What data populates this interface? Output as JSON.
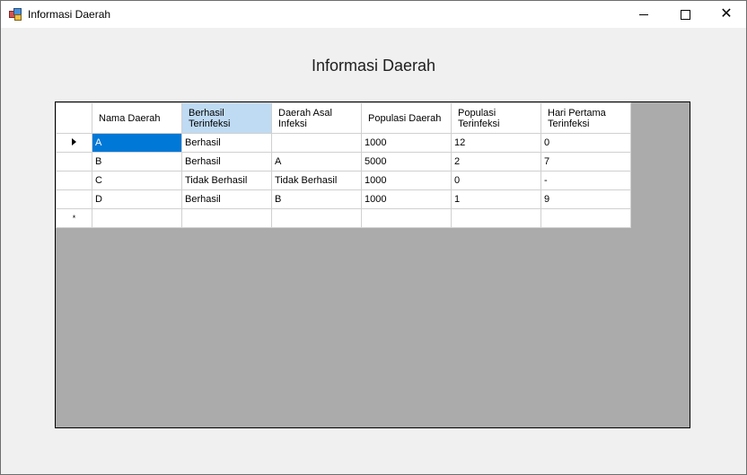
{
  "window": {
    "title": "Informasi Daerah",
    "icon": "app-form-icon",
    "minimize_icon": "minimize-icon",
    "maximize_icon": "maximize-icon",
    "close_icon": "close-icon"
  },
  "form": {
    "heading": "Informasi Daerah"
  },
  "grid": {
    "columns": [
      "Nama Daerah",
      "Berhasil Terinfeksi",
      "Daerah Asal Infeksi",
      "Populasi Daerah",
      "Populasi Terinfeksi",
      "Hari Pertama Terinfeksi"
    ],
    "rows": [
      [
        "A",
        "Berhasil",
        "",
        "1000",
        "12",
        "0"
      ],
      [
        "B",
        "Berhasil",
        "A",
        "5000",
        "2",
        "7"
      ],
      [
        "C",
        "Tidak Berhasil",
        "Tidak Berhasil",
        "1000",
        "0",
        "-"
      ],
      [
        "D",
        "Berhasil",
        "B",
        "1000",
        "1",
        "9"
      ]
    ],
    "current_row_marker": "current-row-arrow-icon",
    "new_row_marker": "*",
    "colors": {
      "selected_header": "#bfdbf3",
      "selected_cell": "#0078d7",
      "background": "#ababab"
    }
  }
}
